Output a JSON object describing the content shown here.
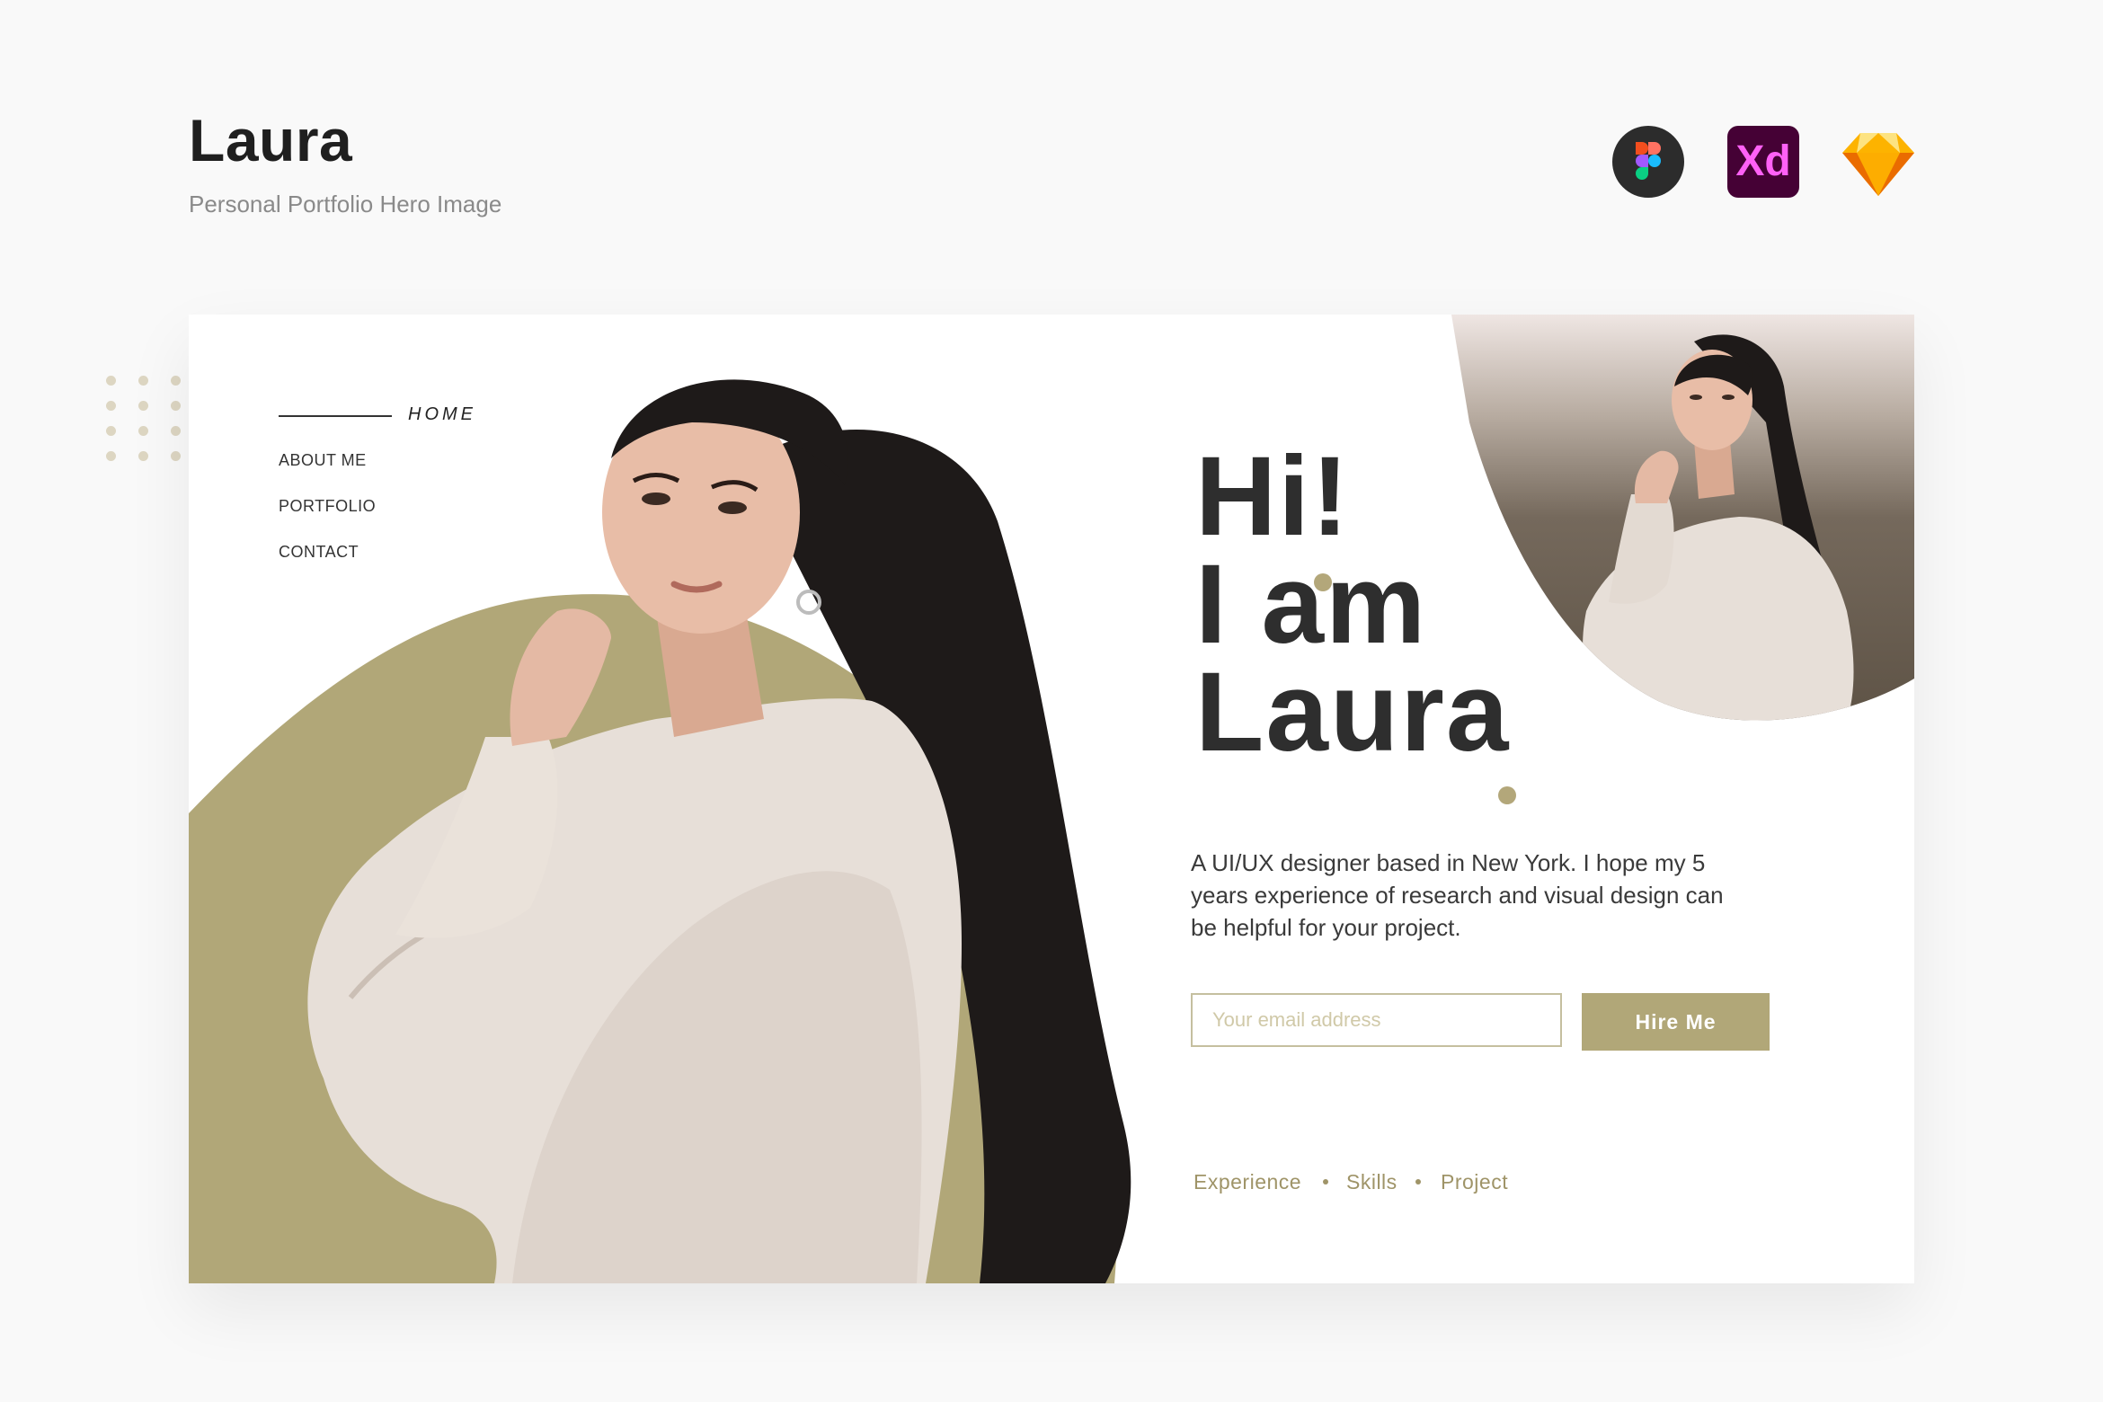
{
  "header": {
    "title": "Laura",
    "subtitle": "Personal Portfolio Hero Image"
  },
  "tools": [
    {
      "name": "figma-icon"
    },
    {
      "name": "xd-icon",
      "label": "Xd"
    },
    {
      "name": "sketch-icon"
    }
  ],
  "nav": {
    "home": "HOME",
    "items": [
      "ABOUT ME",
      "PORTFOLIO",
      "CONTACT"
    ]
  },
  "hero": {
    "line1": "Hi!",
    "line2": "I am",
    "line3": "Laura",
    "description": "A UI/UX designer based in New York. I hope my 5 years experience of research and visual design can be helpful for your project.",
    "email_placeholder": "Your email address",
    "hire_label": "Hire Me",
    "links": [
      "Experience",
      "Skills",
      "Project"
    ]
  },
  "colors": {
    "accent": "#b1a778",
    "text_dark": "#2e2e2e",
    "background": "#f9f9f9",
    "card": "#ffffff"
  }
}
